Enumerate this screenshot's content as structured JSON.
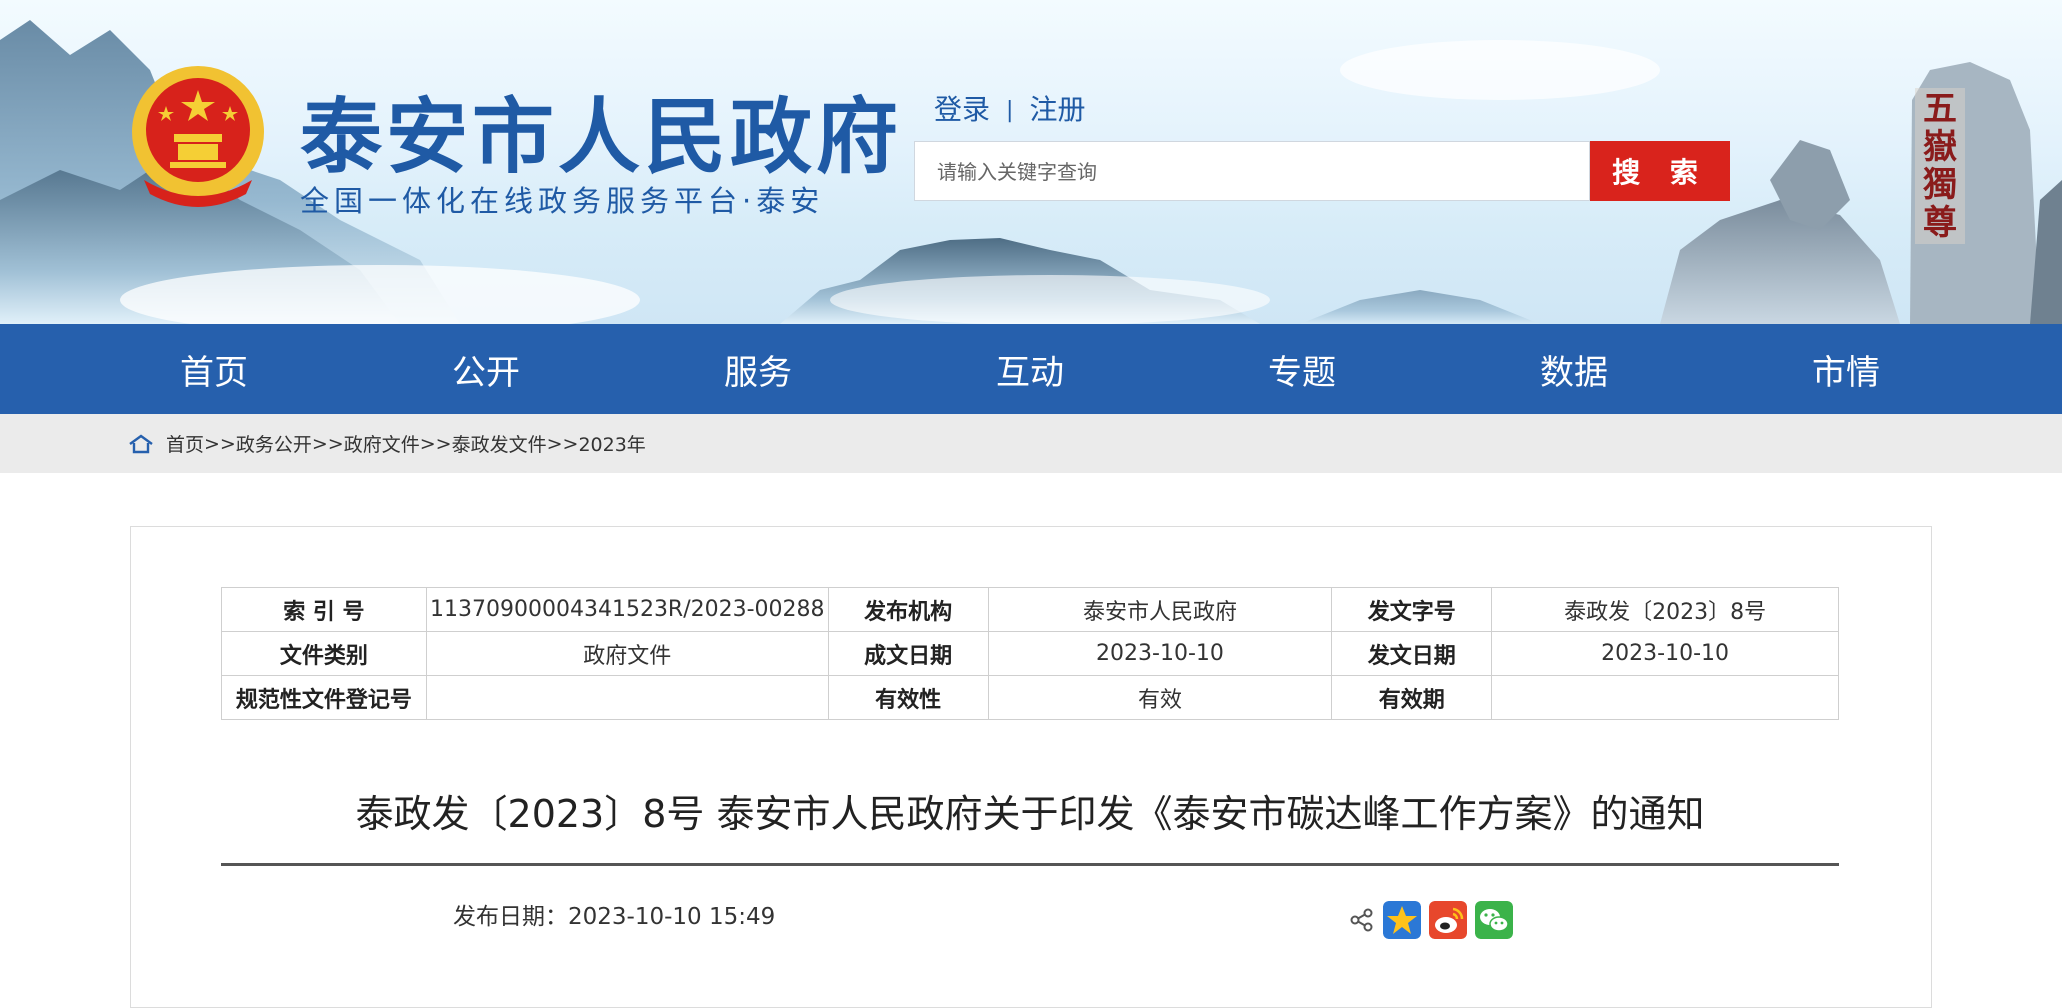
{
  "header": {
    "site_title": "泰安市人民政府",
    "site_subtitle": "全国一体化在线政务服务平台·泰安",
    "login_label": "登录",
    "register_label": "注册",
    "auth_separator": "|",
    "search_placeholder": "请输入关键字查询",
    "search_button": "搜 索"
  },
  "nav": {
    "items": [
      {
        "label": "首页"
      },
      {
        "label": "公开"
      },
      {
        "label": "服务"
      },
      {
        "label": "互动"
      },
      {
        "label": "专题"
      },
      {
        "label": "数据"
      },
      {
        "label": "市情"
      }
    ]
  },
  "breadcrumb": {
    "items": [
      "首页",
      "政务公开",
      "政府文件",
      "泰政发文件",
      "2023年"
    ],
    "separator": ">>"
  },
  "meta": {
    "index_no_label": "索 引 号",
    "index_no": "11370900004341523R/2023-00288",
    "publisher_label": "发布机构",
    "publisher": "泰安市人民政府",
    "doc_no_label": "发文字号",
    "doc_no": "泰政发〔2023〕8号",
    "category_label": "文件类别",
    "category": "政府文件",
    "written_date_label": "成文日期",
    "written_date": "2023-10-10",
    "issue_date_label": "发文日期",
    "issue_date": "2023-10-10",
    "reg_no_label": "规范性文件登记号",
    "reg_no": "",
    "validity_label": "有效性",
    "validity": "有效",
    "valid_period_label": "有效期",
    "valid_period": ""
  },
  "article": {
    "title": "泰政发〔2023〕8号 泰安市人民政府关于印发《泰安市碳达峰工作方案》的通知",
    "publish_date": "发布日期：2023-10-10 15:49"
  },
  "share": {
    "icons": [
      "share-icon",
      "favorite-star-icon",
      "weibo-icon",
      "wechat-icon"
    ]
  },
  "colors": {
    "brand_blue": "#2660ad",
    "search_red": "#d9231c",
    "title_blue": "#1f5aa5"
  }
}
